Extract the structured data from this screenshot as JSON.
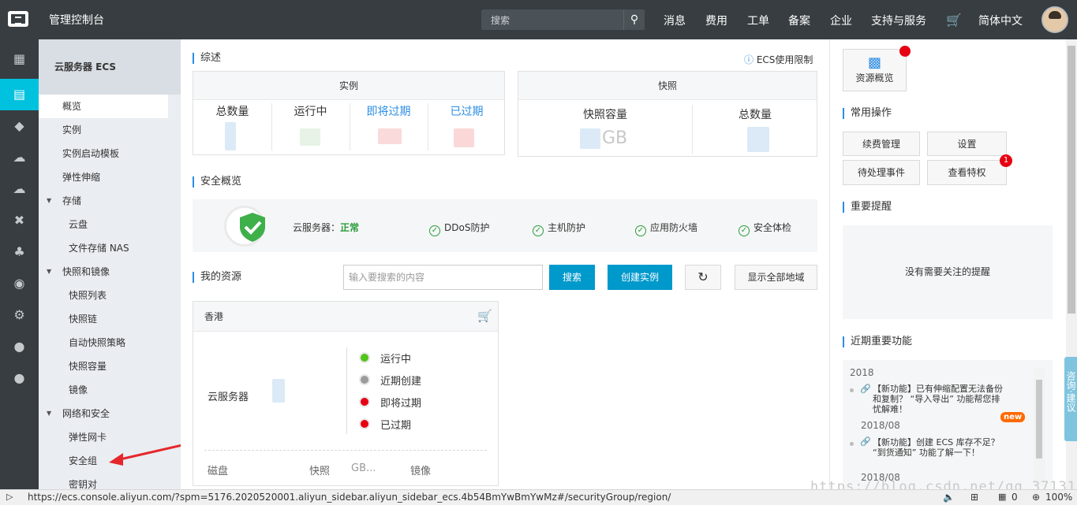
{
  "topbar": {
    "brand": "管理控制台",
    "search_placeholder": "搜索",
    "nav": [
      "消息",
      "费用",
      "工单",
      "备案",
      "企业",
      "支持与服务",
      "简体中文"
    ]
  },
  "sidebar": {
    "title": "云服务器 ECS",
    "items": [
      {
        "label": "概览",
        "type": "item"
      },
      {
        "label": "实例",
        "type": "item"
      },
      {
        "label": "实例启动模板",
        "type": "item"
      },
      {
        "label": "弹性伸缩",
        "type": "item"
      },
      {
        "label": "存储",
        "type": "group"
      },
      {
        "label": "云盘",
        "type": "sub"
      },
      {
        "label": "文件存储 NAS",
        "type": "sub"
      },
      {
        "label": "快照和镜像",
        "type": "group"
      },
      {
        "label": "快照列表",
        "type": "sub"
      },
      {
        "label": "快照链",
        "type": "sub"
      },
      {
        "label": "自动快照策略",
        "type": "sub"
      },
      {
        "label": "快照容量",
        "type": "sub"
      },
      {
        "label": "镜像",
        "type": "sub"
      },
      {
        "label": "网络和安全",
        "type": "group"
      },
      {
        "label": "弹性网卡",
        "type": "sub"
      },
      {
        "label": "安全组",
        "type": "sub"
      },
      {
        "label": "密钥对",
        "type": "sub"
      }
    ]
  },
  "overview": {
    "title": "综述",
    "limit_link": "ECS使用限制",
    "instance_panel": {
      "header": "实例",
      "stats": [
        "总数量",
        "运行中",
        "即将过期",
        "已过期"
      ]
    },
    "snapshot_panel": {
      "header": "快照",
      "stats": [
        "快照容量",
        "总数量"
      ],
      "unit": "GB"
    }
  },
  "security": {
    "title": "安全概览",
    "server_label": "云服务器：",
    "server_status": "正常",
    "checks": [
      "DDoS防护",
      "主机防护",
      "应用防火墙",
      "安全体检"
    ]
  },
  "resources": {
    "title": "我的资源",
    "search_placeholder": "输入要搜索的内容",
    "search_button": "搜索",
    "create_button": "创建实例",
    "show_all_button": "显示全部地域",
    "region_card": {
      "region": "香港",
      "service": "云服务器",
      "statuses": [
        "运行中",
        "近期创建",
        "即将过期",
        "已过期"
      ],
      "bottom": [
        "磁盘",
        "快照",
        "GB...",
        "镜像"
      ]
    }
  },
  "right": {
    "resource_overview": "资源概览",
    "common_ops_title": "常用操作",
    "ops": [
      "续费管理",
      "设置",
      "待处理事件",
      "查看特权"
    ],
    "ops_badge": "1",
    "reminders_title": "重要提醒",
    "no_reminders": "没有需要关注的提醒",
    "features_title": "近期重要功能",
    "news": [
      {
        "year": "2018"
      },
      {
        "text": "【新功能】已有伸缩配置无法备份和复制？ “导入导出” 功能帮您排忧解难！",
        "tag": "new"
      },
      {
        "date": "2018/08"
      },
      {
        "text": "【新功能】创建 ECS 库存不足？ “到货通知” 功能了解一下！"
      },
      {
        "date": "2018/08"
      }
    ],
    "feedback": "咨询·建议"
  },
  "statusbar": {
    "url": "https://ecs.console.aliyun.com/?spm=5176.2020520001.aliyun_sidebar.aliyun_sidebar_ecs.4b54BmYwBmYwMz#/securityGroup/region/",
    "count": "0",
    "zoom": "100%"
  },
  "watermark": "https://blog.csdn.net/qq_37131111",
  "colors": {
    "accent": "#00c1de",
    "primary_button": "#0099cc",
    "ok": "#2a9d3a",
    "topbar": "#373d41"
  }
}
